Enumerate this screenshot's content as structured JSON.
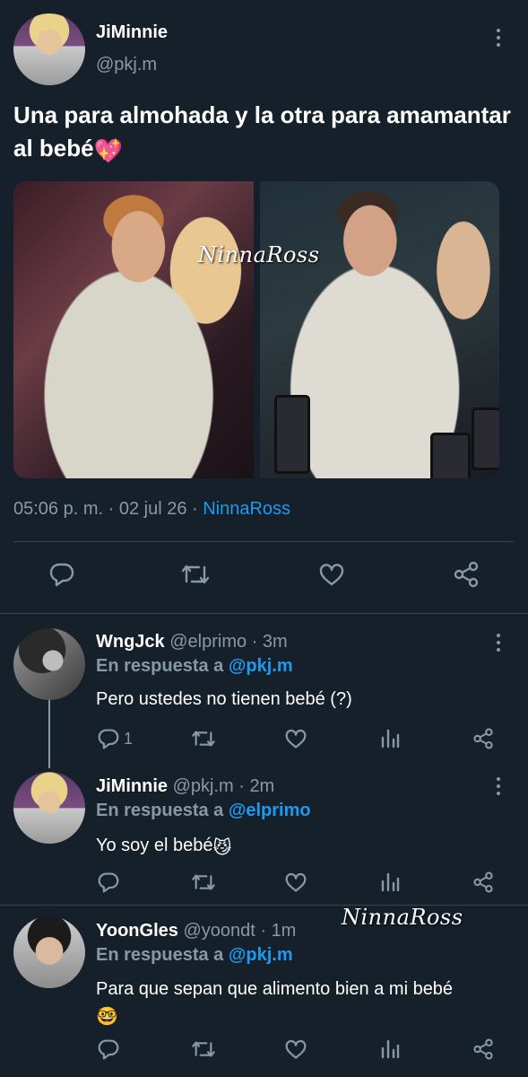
{
  "main_tweet": {
    "display_name": "JiMinnie",
    "handle": "@pkj.m",
    "text": "Una para almohada y la otra para amamantar al bebé",
    "text_emoji": "💖",
    "watermark": "NinnaRoss",
    "time": "05:06 p. m. · 02 jul 26 · ",
    "source": "NinnaRoss"
  },
  "replies": [
    {
      "display_name": "WngJck",
      "handle": "@elprimo · 3m",
      "replying_label": "En respuesta a",
      "replying_to": "@pkj.m",
      "text": "Pero ustedes no tienen bebé (?)",
      "reply_count": "1"
    },
    {
      "display_name": "JiMinnie",
      "handle": "@pkj.m · 2m",
      "replying_label": "En respuesta a",
      "replying_to": "@elprimo",
      "text": "Yo soy el bebé",
      "text_emoji": "😼"
    },
    {
      "display_name": "YoonGles",
      "handle": "@yoondt · 1m",
      "replying_label": "En respuesta a",
      "replying_to": "@pkj.m",
      "text": "Para que sepan que alimento bien a mi bebé",
      "text_emoji": "🤓",
      "watermark": "NinnaRoss"
    }
  ],
  "colors": {
    "background": "#15202b",
    "text": "#ffffff",
    "secondary": "#8899a6",
    "accent": "#1d9bf0",
    "divider": "#38444d"
  },
  "icons": [
    "more-icon",
    "reply-icon",
    "retweet-icon",
    "like-icon",
    "share-icon",
    "analytics-icon"
  ]
}
